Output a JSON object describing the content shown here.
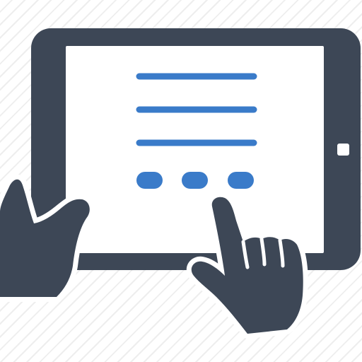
{
  "icon": {
    "name": "tablet-touch-icon",
    "colors": {
      "device": "#3d4756",
      "accent": "#3a7bc9",
      "screen": "#ffffff",
      "outline": "#ffffff"
    },
    "screen_lines": 3,
    "screen_dots": 3
  }
}
